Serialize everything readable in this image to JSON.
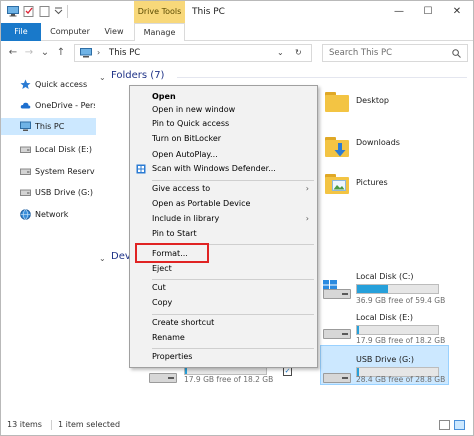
{
  "window": {
    "title": "This PC",
    "contextual_tab": "Drive Tools",
    "controls": {
      "minimize": "—",
      "maximize": "☐",
      "close": "✕"
    }
  },
  "ribbon": {
    "tabs": [
      {
        "label": "File"
      },
      {
        "label": "Computer"
      },
      {
        "label": "View"
      },
      {
        "label": "Manage"
      }
    ]
  },
  "address": {
    "back": "←",
    "forward": "→",
    "recent": "⌄",
    "up": "↑",
    "path_chevron": "›",
    "path": "This PC",
    "search_placeholder": "Search This PC"
  },
  "nav": {
    "items": [
      {
        "label": "Quick access",
        "icon": "star-icon"
      },
      {
        "label": "OneDrive - Perso",
        "icon": "cloud-icon"
      },
      {
        "label": "This PC",
        "icon": "computer-icon",
        "selected": true
      },
      {
        "label": "Local Disk (E:)",
        "icon": "drive-icon"
      },
      {
        "label": "System Reserved",
        "icon": "drive-icon"
      },
      {
        "label": "USB Drive (G:)",
        "icon": "usb-drive-icon"
      },
      {
        "label": "Network",
        "icon": "network-icon"
      }
    ]
  },
  "content": {
    "folders_header": "Folders (7)",
    "devices_header": "Dev",
    "folders": [
      {
        "label": "Desktop"
      },
      {
        "label": "Downloads"
      },
      {
        "label": "Pictures"
      }
    ],
    "drives": [
      {
        "label": "Local Disk (C:)",
        "free": "36.9 GB free of 59.4 GB",
        "used_fraction": 0.38
      },
      {
        "label": "Local Disk (E:)",
        "free": "17.9 GB free of 18.2 GB",
        "used_fraction": 0.02
      },
      {
        "label": "USB Drive (G:)",
        "free": "28.4 GB free of 28.8 GB",
        "used_fraction": 0.02,
        "selected": true
      }
    ],
    "partial_drive": {
      "free": "17.9 GB free of 18.2 GB"
    }
  },
  "context_menu": {
    "items": [
      {
        "label": "Open",
        "bold": true
      },
      {
        "label": "Open in new window"
      },
      {
        "label": "Pin to Quick access"
      },
      {
        "label": "Turn on BitLocker"
      },
      {
        "label": "Open AutoPlay..."
      },
      {
        "label": "Scan with Windows Defender...",
        "icon": "windows-defender-icon"
      },
      {
        "separator": true
      },
      {
        "label": "Give access to",
        "submenu": true
      },
      {
        "label": "Open as Portable Device"
      },
      {
        "label": "Include in library",
        "submenu": true
      },
      {
        "label": "Pin to Start"
      },
      {
        "separator": true
      },
      {
        "label": "Format...",
        "highlighted": true
      },
      {
        "label": "Eject"
      },
      {
        "separator": true
      },
      {
        "label": "Cut"
      },
      {
        "label": "Copy"
      },
      {
        "separator": true
      },
      {
        "label": "Create shortcut"
      },
      {
        "label": "Rename"
      },
      {
        "separator": true
      },
      {
        "label": "Properties"
      }
    ],
    "submenu_arrow": "›",
    "highlight_color": "#e02323"
  },
  "status": {
    "items_count": "13 items",
    "selected": "1 item selected"
  },
  "colors": {
    "accent": "#1979ca",
    "drive_tools": "#f8d87a",
    "selection": "#cce8ff",
    "capacity_fill": "#26a0da",
    "folder": "#f3c443"
  }
}
